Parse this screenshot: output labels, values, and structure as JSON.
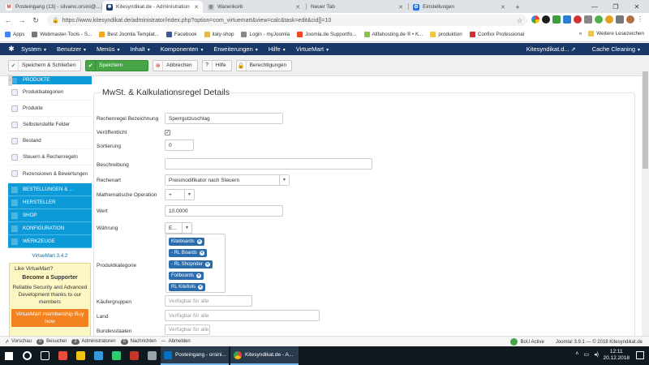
{
  "browser": {
    "tabs": [
      {
        "label": "Posteingang (13) - silvano.orsini@...",
        "icon_color": "#d93025",
        "active": false
      },
      {
        "label": "Kitesyndikat.de - Administration",
        "icon_color": "#1a3867",
        "active": true
      },
      {
        "label": "Warenkorb",
        "icon_color": "#888888",
        "active": false
      },
      {
        "label": "Neuer Tab",
        "icon_color": "#ffffff",
        "active": false
      },
      {
        "label": "Einstellungen",
        "icon_color": "#1a73e8",
        "active": false
      }
    ],
    "url": "https://www.kitesyndikat.de/administrator/index.php?option=com_virtuemart&view=calc&task=edit&cid[]=10",
    "bookmarks": [
      {
        "label": "Apps",
        "icon_color": "#4285f4"
      },
      {
        "label": "Webmaster-Tools - S...",
        "icon_color": "#777777"
      },
      {
        "label": "Best Joomla Templat...",
        "icon_color": "#f5a623"
      },
      {
        "label": "Facebook",
        "icon_color": "#3b5998"
      },
      {
        "label": "italy-shop",
        "icon_color": "#e2b94a"
      },
      {
        "label": "Login - myJoomla",
        "icon_color": "#888888"
      },
      {
        "label": "Joomla.de Supportfo...",
        "icon_color": "#f44321"
      },
      {
        "label": "Allfahosting.de ® • K...",
        "icon_color": "#8bc34a"
      },
      {
        "label": "produktion",
        "icon_color": "#f4c542"
      },
      {
        "label": "Confixx Professional",
        "icon_color": "#d32f2f"
      }
    ],
    "bookmarks_overflow": "»",
    "other_bookmarks": "Weitere Lesezeichen"
  },
  "joomla_menu": {
    "items": [
      "System",
      "Benutzer",
      "Menüs",
      "Inhalt",
      "Komponenten",
      "Erweiterungen",
      "Hilfe",
      "VirtueMart"
    ],
    "site_name": "Kitesyndikat.d...",
    "cache": "Cache Cleaning"
  },
  "toolbar": {
    "save_close": "Speichern & Schließen",
    "save": "Speichern",
    "cancel": "Abbrechen",
    "help": "Hilfe",
    "permissions": "Berechtigungen"
  },
  "sidebar": {
    "header": "PRODUKTE",
    "items": [
      "Produktkategorien",
      "Produkte",
      "Selbsterstellte Felder",
      "Bestand",
      "Steuern & Rechenregeln",
      "Rezensionen & Bewertungen"
    ],
    "categories": [
      "BESTELLUNGEN & ...",
      "HERSTELLER",
      "SHOP",
      "KONFIGURATION",
      "WERKZEUGE"
    ],
    "version": "VirtueMart 3.4.2",
    "promo": {
      "question": "Like VirtueMart?",
      "headline": "Become a Supporter",
      "body": "Reliable Security and Advanced Development thanks to our members",
      "cta": "VirtueMart membership Buy now"
    }
  },
  "form": {
    "title": "MwSt. & Kalkulationsregel Details",
    "fields": {
      "name_label": "Rechenregel Bezeichnung",
      "name_value": "Sperrgutzuschlag",
      "published_label": "Veröffentlicht",
      "published_mark": "✓",
      "order_label": "Sortierung",
      "order_value": "0",
      "description_label": "Beschreibung",
      "calctype_label": "Rechenart",
      "calctype_value": "Preismodifikator nach Steuern",
      "operation_label": "Mathematische Operation",
      "operation_value": "+",
      "value_label": "Wert",
      "value_value": "10.0000",
      "currency_label": "Währung",
      "currency_value": "E...",
      "category_label": "Produktkategorie",
      "categories": [
        "Kiteboards",
        "- RL Boards",
        "- RL Shopnder",
        "Foilboards",
        "RL Kitefoils"
      ],
      "shoppergroups_label": "Käufergruppen",
      "shoppergroups_placeholder": "Verfügbar für alle",
      "country_label": "Land",
      "country_placeholder": "Verfügbar für alle",
      "states_label": "Bundesstaaten",
      "states_placeholder": "Verfügbar für alle"
    }
  },
  "statusbar": {
    "preview": "Vorschau",
    "visitors_count": "0",
    "visitors": "Besucher",
    "admins_count": "2",
    "admins": "Administratoren",
    "messages_count": "0",
    "messages": "Nachrichten",
    "logout": "Abmelden",
    "bou": "BoU Active",
    "footer": "Joomla! 3.9.1 — © 2018 Kitesyndikat.de"
  },
  "taskbar": {
    "task1": "Posteingang - orsini...",
    "task2": "Kitesyndikat.de - A...",
    "time": "12:11",
    "date": "20.12.2018"
  }
}
